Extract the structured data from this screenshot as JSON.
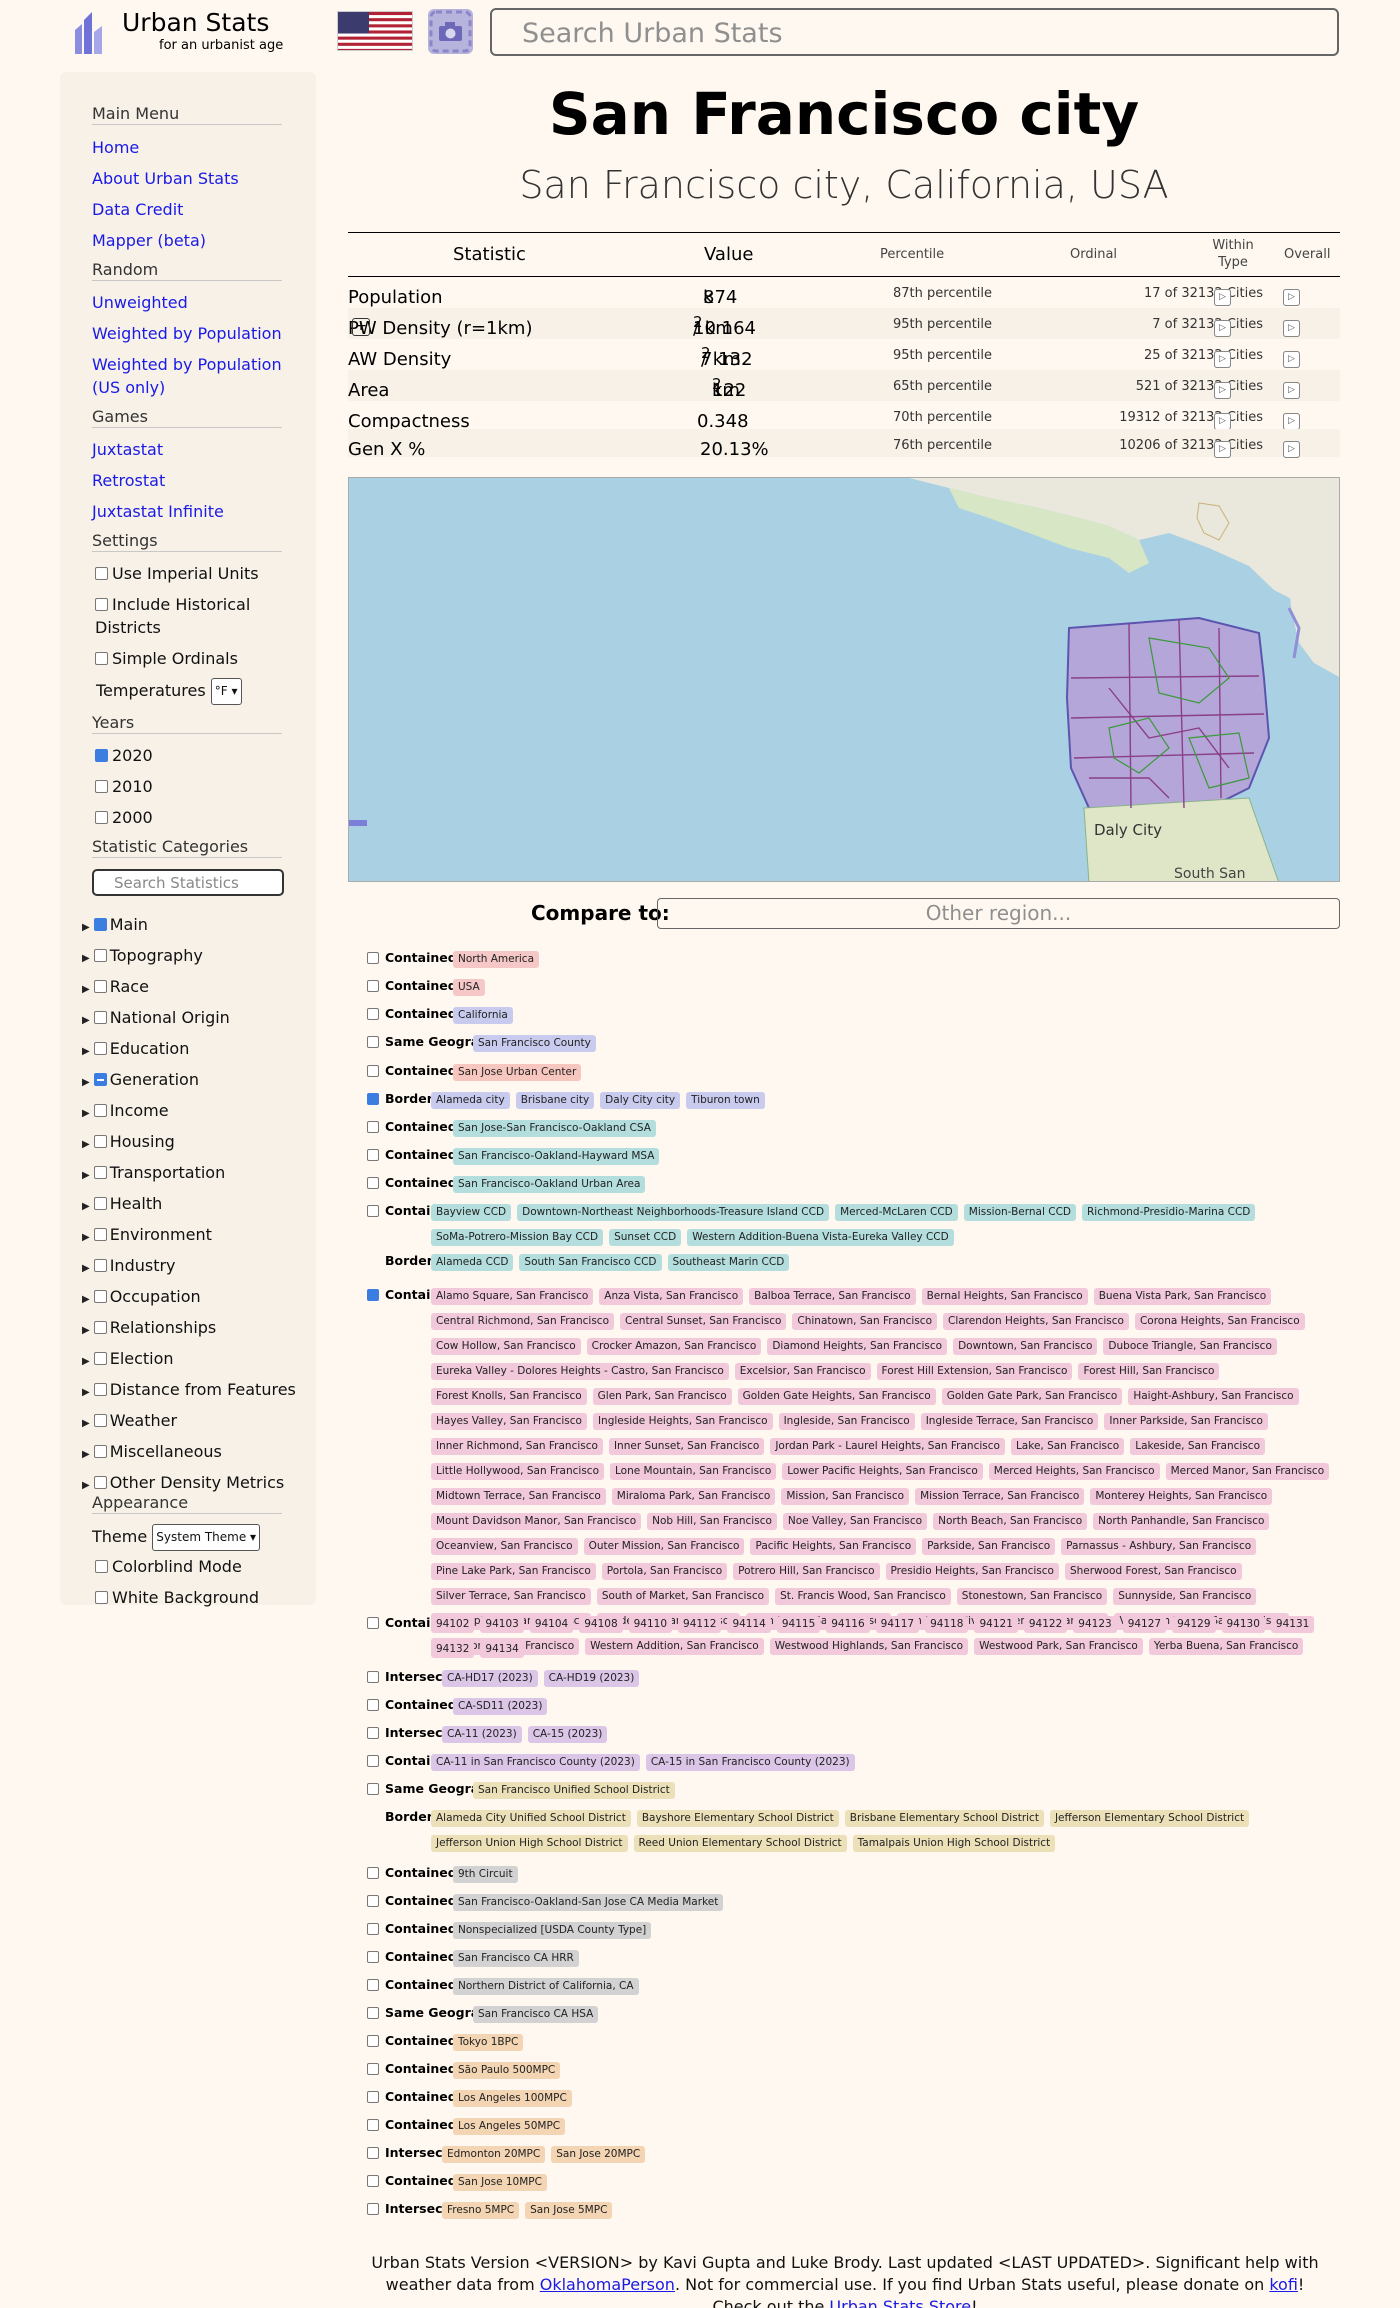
{
  "header": {
    "logo_title": "Urban Stats",
    "logo_subtitle": "for an urbanist age",
    "search_placeholder": "Search Urban Stats",
    "flag_icon": "us-flag-icon",
    "screenshot_icon": "camera-icon"
  },
  "sidebar": {
    "main_menu": {
      "heading": "Main Menu",
      "items": [
        "Home",
        "About Urban Stats",
        "Data Credit",
        "Mapper (beta)"
      ]
    },
    "random": {
      "heading": "Random",
      "items": [
        "Unweighted",
        "Weighted by Population",
        "Weighted by Population (US only)"
      ]
    },
    "games": {
      "heading": "Games",
      "items": [
        "Juxtastat",
        "Retrostat",
        "Juxtastat Infinite"
      ]
    },
    "settings": {
      "heading": "Settings",
      "use_imperial": "Use Imperial Units",
      "include_historical": "Include Historical Districts",
      "simple_ordinals": "Simple Ordinals",
      "temperatures_label": "Temperatures",
      "temperatures_value": "°F"
    },
    "years": {
      "heading": "Years",
      "items": [
        {
          "label": "2020",
          "checked": true
        },
        {
          "label": "2010",
          "checked": false
        },
        {
          "label": "2000",
          "checked": false
        }
      ]
    },
    "categories": {
      "heading": "Statistic Categories",
      "search_placeholder": "Search Statistics",
      "items": [
        {
          "label": "Main",
          "state": "on"
        },
        {
          "label": "Topography",
          "state": "off"
        },
        {
          "label": "Race",
          "state": "off"
        },
        {
          "label": "National Origin",
          "state": "off"
        },
        {
          "label": "Education",
          "state": "off"
        },
        {
          "label": "Generation",
          "state": "ind"
        },
        {
          "label": "Income",
          "state": "off"
        },
        {
          "label": "Housing",
          "state": "off"
        },
        {
          "label": "Transportation",
          "state": "off"
        },
        {
          "label": "Health",
          "state": "off"
        },
        {
          "label": "Environment",
          "state": "off"
        },
        {
          "label": "Industry",
          "state": "off"
        },
        {
          "label": "Occupation",
          "state": "off"
        },
        {
          "label": "Relationships",
          "state": "off"
        },
        {
          "label": "Election",
          "state": "off"
        },
        {
          "label": "Distance from Features",
          "state": "off"
        },
        {
          "label": "Weather",
          "state": "off"
        },
        {
          "label": "Miscellaneous",
          "state": "off"
        },
        {
          "label": "Other Density Metrics",
          "state": "off"
        }
      ]
    },
    "appearance": {
      "heading": "Appearance",
      "theme_label": "Theme",
      "theme_value": "System Theme",
      "colorblind": "Colorblind Mode",
      "white_bg": "White Background"
    }
  },
  "main": {
    "title": "San Francisco city",
    "subtitle": "San Francisco city, California, USA",
    "table_headers": {
      "statistic": "Statistic",
      "value": "Value",
      "percentile": "Percentile",
      "ordinal": "Ordinal",
      "within_type": "Within Type",
      "overall": "Overall"
    },
    "stats": [
      {
        "name": "Population",
        "value": "874",
        "unit": "k",
        "sup": "",
        "percentile": "87th percentile",
        "ordinal": "17 of 32132 Cities",
        "plus": false
      },
      {
        "name": "PW Density (r=1km)",
        "value": "10 164",
        "unit": "/ km",
        "sup": "2",
        "percentile": "95th percentile",
        "ordinal": "7 of 32132 Cities",
        "plus": true
      },
      {
        "name": "AW Density",
        "value": "7 132",
        "unit": "/ km",
        "sup": "2",
        "percentile": "95th percentile",
        "ordinal": "25 of 32132 Cities",
        "plus": false
      },
      {
        "name": "Area",
        "value": "122",
        "unit": "km",
        "sup": "2",
        "percentile": "65th percentile",
        "ordinal": "521 of 32132 Cities",
        "plus": false
      },
      {
        "name": "Compactness",
        "value": "0.348",
        "unit": "",
        "sup": "",
        "percentile": "70th percentile",
        "ordinal": "19312 of 32132 Cities",
        "plus": false
      },
      {
        "name": "Gen X %",
        "value": "20.13%",
        "unit": "",
        "sup": "",
        "percentile": "76th percentile",
        "ordinal": "10206 of 32132 Cities",
        "plus": false
      }
    ],
    "map": {
      "label_daly": "Daly City",
      "label_south": "South San"
    },
    "compare_label": "Compare to:",
    "compare_placeholder": "Other region..."
  },
  "related": [
    {
      "rows": [
        {
          "type": "Contained By",
          "tags": [
            "North America"
          ]
        }
      ],
      "color": "#f5c7c7",
      "checked": false
    },
    {
      "rows": [
        {
          "type": "Contained By",
          "tags": [
            "USA"
          ]
        }
      ],
      "color": "#f5c7c7",
      "checked": false
    },
    {
      "rows": [
        {
          "type": "Contained By",
          "tags": [
            "California"
          ]
        }
      ],
      "color": "#c8cbee",
      "checked": false
    },
    {
      "rows": [
        {
          "type": "Same Geography",
          "tags": [
            "San Francisco County"
          ]
        }
      ],
      "color": "#c8cbee",
      "checked": false
    },
    {
      "rows": [
        {
          "type": "Contained By",
          "tags": [
            "San Jose Urban Center"
          ]
        }
      ],
      "color": "#f7c7bf",
      "checked": false
    },
    {
      "rows": [
        {
          "type": "Borders",
          "tags": [
            "Alameda city",
            "Brisbane city",
            "Daly City city",
            "Tiburon town"
          ]
        }
      ],
      "color": "#c8cbee",
      "checked": true
    },
    {
      "rows": [
        {
          "type": "Contained By",
          "tags": [
            "San Jose-San Francisco-Oakland CSA"
          ]
        }
      ],
      "color": "#b3dedd",
      "checked": false
    },
    {
      "rows": [
        {
          "type": "Contained By",
          "tags": [
            "San Francisco-Oakland-Hayward MSA"
          ]
        }
      ],
      "color": "#b3dedd",
      "checked": false
    },
    {
      "rows": [
        {
          "type": "Contained By",
          "tags": [
            "San Francisco-Oakland Urban Area"
          ]
        }
      ],
      "color": "#b3dedd",
      "checked": false
    },
    {
      "rows": [
        {
          "type": "Contains",
          "tags": [
            "Bayview CCD",
            "Downtown-Northeast Neighborhoods-Treasure Island CCD",
            "Merced-McLaren CCD",
            "Mission-Bernal CCD",
            "Richmond-Presidio-Marina CCD",
            "SoMa-Potrero-Mission Bay CCD",
            "Sunset CCD",
            "Western Addition-Buena Vista-Eureka Valley CCD"
          ]
        },
        {
          "type": "Borders",
          "tags": [
            "Alameda CCD",
            "South San Francisco CCD",
            "Southeast Marin CCD"
          ]
        }
      ],
      "color": "#b3dedd",
      "checked": false
    },
    {
      "rows": [
        {
          "type": "Contains",
          "tags": [
            "Alamo Square, San Francisco",
            "Anza Vista, San Francisco",
            "Balboa Terrace, San Francisco",
            "Bernal Heights, San Francisco",
            "Buena Vista Park, San Francisco",
            "Central Richmond, San Francisco",
            "Central Sunset, San Francisco",
            "Chinatown, San Francisco",
            "Clarendon Heights, San Francisco",
            "Corona Heights, San Francisco",
            "Cow Hollow, San Francisco",
            "Crocker Amazon, San Francisco",
            "Diamond Heights, San Francisco",
            "Downtown, San Francisco",
            "Duboce Triangle, San Francisco",
            "Eureka Valley - Dolores Heights - Castro, San Francisco",
            "Excelsior, San Francisco",
            "Forest Hill Extension, San Francisco",
            "Forest Hill, San Francisco",
            "Forest Knolls, San Francisco",
            "Glen Park, San Francisco",
            "Golden Gate Heights, San Francisco",
            "Golden Gate Park, San Francisco",
            "Haight-Ashbury, San Francisco",
            "Hayes Valley, San Francisco",
            "Ingleside Heights, San Francisco",
            "Ingleside, San Francisco",
            "Ingleside Terrace, San Francisco",
            "Inner Parkside, San Francisco",
            "Inner Richmond, San Francisco",
            "Inner Sunset, San Francisco",
            "Jordan Park - Laurel Heights, San Francisco",
            "Lake, San Francisco",
            "Lakeside, San Francisco",
            "Little Hollywood, San Francisco",
            "Lone Mountain, San Francisco",
            "Lower Pacific Heights, San Francisco",
            "Merced Heights, San Francisco",
            "Merced Manor, San Francisco",
            "Midtown Terrace, San Francisco",
            "Miraloma Park, San Francisco",
            "Mission, San Francisco",
            "Mission Terrace, San Francisco",
            "Monterey Heights, San Francisco",
            "Mount Davidson Manor, San Francisco",
            "Nob Hill, San Francisco",
            "Noe Valley, San Francisco",
            "North Beach, San Francisco",
            "North Panhandle, San Francisco",
            "Oceanview, San Francisco",
            "Outer Mission, San Francisco",
            "Pacific Heights, San Francisco",
            "Parkside, San Francisco",
            "Parnassus - Ashbury, San Francisco",
            "Pine Lake Park, San Francisco",
            "Portola, San Francisco",
            "Potrero Hill, San Francisco",
            "Presidio Heights, San Francisco",
            "Sherwood Forest, San Francisco",
            "Silver Terrace, San Francisco",
            "South of Market, San Francisco",
            "St. Francis Wood, San Francisco",
            "Stonestown, San Francisco",
            "Sunnyside, San Francisco",
            "Telegraph Hill, San Francisco",
            "Tenderloin, San Francisco",
            "Twin Peaks, San Francisco",
            "Van Ness - Civic Center, San Francisco",
            "Visitacion Valley, San Francisco",
            "West Portal, San Francisco",
            "Western Addition, San Francisco",
            "Westwood Highlands, San Francisco",
            "Westwood Park, San Francisco",
            "Yerba Buena, San Francisco"
          ]
        }
      ],
      "color": "#f2c9da",
      "checked": true
    },
    {
      "rows": [
        {
          "type": "Contains",
          "tags": [
            "94102",
            "94103",
            "94104",
            "94108",
            "94110",
            "94112",
            "94114",
            "94115",
            "94116",
            "94117",
            "94118",
            "94121",
            "94122",
            "94123",
            "94127",
            "94129",
            "94130",
            "94131",
            "94132",
            "94134"
          ]
        }
      ],
      "color": "#f2c9da",
      "checked": false
    },
    {
      "rows": [
        {
          "type": "Intersects",
          "tags": [
            "CA-HD17 (2023)",
            "CA-HD19 (2023)"
          ]
        }
      ],
      "color": "#dcc6e8",
      "checked": false
    },
    {
      "rows": [
        {
          "type": "Contained By",
          "tags": [
            "CA-SD11 (2023)"
          ]
        }
      ],
      "color": "#dcc6e8",
      "checked": false
    },
    {
      "rows": [
        {
          "type": "Intersects",
          "tags": [
            "CA-11 (2023)",
            "CA-15 (2023)"
          ]
        }
      ],
      "color": "#dcc6e8",
      "checked": false
    },
    {
      "rows": [
        {
          "type": "Contains",
          "tags": [
            "CA-11 in San Francisco County (2023)",
            "CA-15 in San Francisco County (2023)"
          ]
        }
      ],
      "color": "#dcc6e8",
      "checked": false
    },
    {
      "rows": [
        {
          "type": "Same Geography",
          "tags": [
            "San Francisco Unified School District"
          ]
        },
        {
          "type": "Borders",
          "tags": [
            "Alameda City Unified School District",
            "Bayshore Elementary School District",
            "Brisbane Elementary School District",
            "Jefferson Elementary School District",
            "Jefferson Union High School District",
            "Reed Union Elementary School District",
            "Tamalpais Union High School District"
          ]
        }
      ],
      "color": "#ece0b8",
      "checked": false
    },
    {
      "rows": [
        {
          "type": "Contained By",
          "tags": [
            "9th Circuit"
          ]
        }
      ],
      "color": "#d2d2d2",
      "checked": false
    },
    {
      "rows": [
        {
          "type": "Contained By",
          "tags": [
            "San Francisco-Oakland-San Jose CA Media Market"
          ]
        }
      ],
      "color": "#d2d2d2",
      "checked": false
    },
    {
      "rows": [
        {
          "type": "Contained By",
          "tags": [
            "Nonspecialized [USDA County Type]"
          ]
        }
      ],
      "color": "#d2d2d2",
      "checked": false
    },
    {
      "rows": [
        {
          "type": "Contained By",
          "tags": [
            "San Francisco CA HRR"
          ]
        }
      ],
      "color": "#d2d2d2",
      "checked": false
    },
    {
      "rows": [
        {
          "type": "Contained By",
          "tags": [
            "Northern District of California, CA"
          ]
        }
      ],
      "color": "#d2d2d2",
      "checked": false
    },
    {
      "rows": [
        {
          "type": "Same Geography",
          "tags": [
            "San Francisco CA HSA"
          ]
        }
      ],
      "color": "#d2d2d2",
      "checked": false
    },
    {
      "rows": [
        {
          "type": "Contained By",
          "tags": [
            "Tokyo 1BPC"
          ]
        }
      ],
      "color": "#f3d4b3",
      "checked": false
    },
    {
      "rows": [
        {
          "type": "Contained By",
          "tags": [
            "São Paulo 500MPC"
          ]
        }
      ],
      "color": "#f3d4b3",
      "checked": false
    },
    {
      "rows": [
        {
          "type": "Contained By",
          "tags": [
            "Los Angeles 100MPC"
          ]
        }
      ],
      "color": "#f3d4b3",
      "checked": false
    },
    {
      "rows": [
        {
          "type": "Contained By",
          "tags": [
            "Los Angeles 50MPC"
          ]
        }
      ],
      "color": "#f3d4b3",
      "checked": false
    },
    {
      "rows": [
        {
          "type": "Intersects",
          "tags": [
            "Edmonton 20MPC",
            "San Jose 20MPC"
          ]
        }
      ],
      "color": "#f3d4b3",
      "checked": false
    },
    {
      "rows": [
        {
          "type": "Contained By",
          "tags": [
            "San Jose 10MPC"
          ]
        }
      ],
      "color": "#f3d4b3",
      "checked": false
    },
    {
      "rows": [
        {
          "type": "Intersects",
          "tags": [
            "Fresno 5MPC",
            "San Jose 5MPC"
          ]
        }
      ],
      "color": "#f3d4b3",
      "checked": false
    }
  ],
  "footer": {
    "line1": "Urban Stats Version <VERSION> by Kavi Gupta and Luke Brody. Last updated <LAST UPDATED>. Significant help with weather data from ",
    "link1": "OklahomaPerson",
    "text2": ". Not for commercial use. If you find Urban Stats useful, please donate on ",
    "link2": "kofi",
    "text3": "! Check out the ",
    "link3": "Urban Stats Store",
    "text4": "!"
  },
  "colors": {
    "background": "#fff8f0",
    "sidebar": "#f7f1e8",
    "link": "#1a1ae6",
    "checkbox": "#3b7de0"
  }
}
